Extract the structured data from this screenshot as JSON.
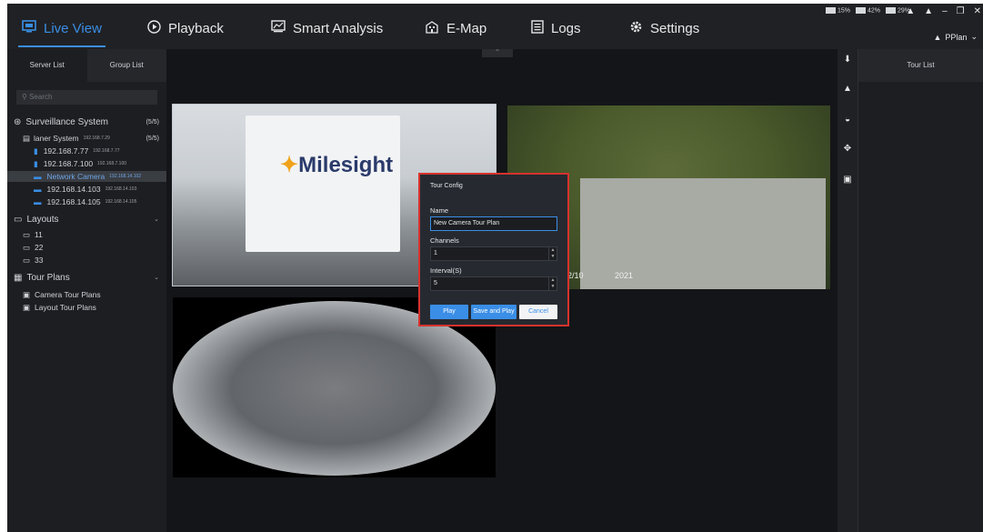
{
  "nav": {
    "live_view": "Live View",
    "playback": "Playback",
    "smart_analysis": "Smart Analysis",
    "emap": "E-Map",
    "logs": "Logs",
    "settings": "Settings"
  },
  "status": {
    "cpu": "15%",
    "mem": "42%",
    "net": "29%"
  },
  "user": "PPlan",
  "left_tabs": {
    "server_list": "Server List",
    "group_list": "Group List"
  },
  "search": {
    "placeholder": "Search"
  },
  "tree": {
    "surveillance": {
      "label": "Surveillance System",
      "count": "(5/5)"
    },
    "server": {
      "label": "laner System",
      "ip": "192.168.7.29",
      "count": "(5/5)"
    },
    "devices": [
      {
        "label": "192.168.7.77",
        "ip": "192.168.7.77"
      },
      {
        "label": "192.168.7.100",
        "ip": "192.168.7.100"
      },
      {
        "label": "Network Camera",
        "ip": "192.168.14.102"
      },
      {
        "label": "192.168.14.103",
        "ip": "192.168.14.103"
      },
      {
        "label": "192.168.14.105",
        "ip": "192.168.14.105"
      }
    ],
    "layouts": {
      "label": "Layouts",
      "items": [
        "11",
        "22",
        "33"
      ]
    },
    "tour_plans": {
      "label": "Tour Plans",
      "items": [
        "Camera Tour Plans",
        "Layout Tour Plans"
      ]
    }
  },
  "video": {
    "logo": "Milesight",
    "tile2_tag_a": "2/10",
    "tile2_tag_b": "2021"
  },
  "dialog": {
    "title": "Tour Config",
    "name_label": "Name",
    "name_value": "New Camera Tour Plan",
    "channels_label": "Channels",
    "channels_value": "1",
    "interval_label": "Interval(S)",
    "interval_value": "5",
    "play": "Play",
    "save_play": "Save and Play",
    "cancel": "Cancel"
  },
  "right_panel": {
    "title": "Tour List"
  },
  "colors": {
    "accent": "#3a8ee6",
    "highlight_border": "#d7322d"
  }
}
